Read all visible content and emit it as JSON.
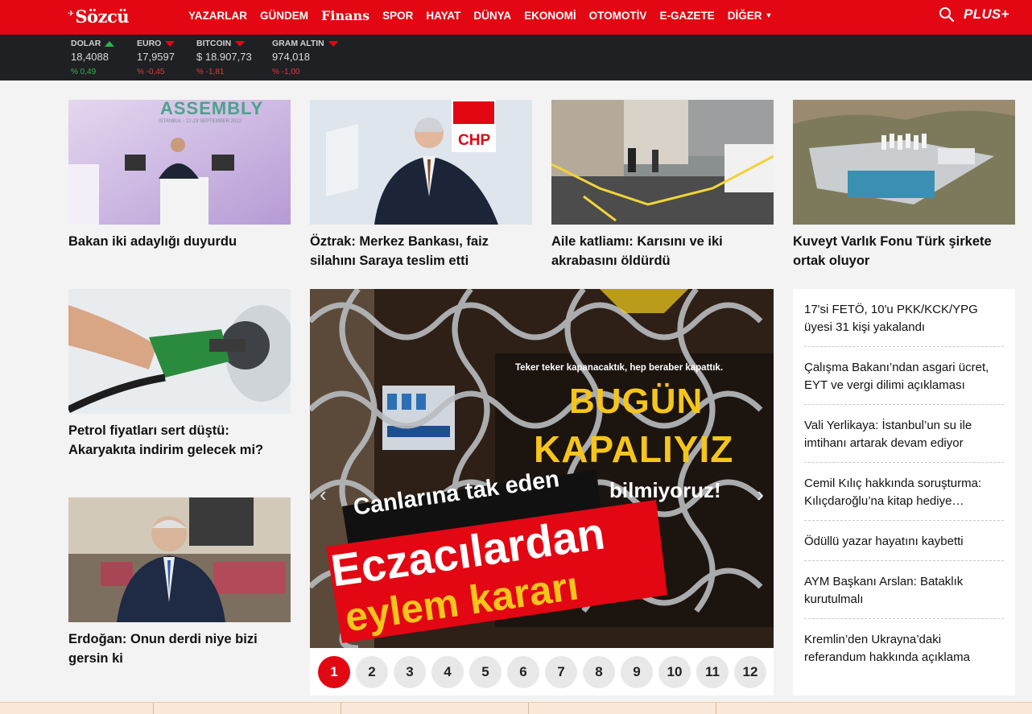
{
  "brand": {
    "name": "Sözcü",
    "plus_label": "PLUS+"
  },
  "nav": [
    "YAZARLAR",
    "GÜNDEM",
    "Finans",
    "SPOR",
    "HAYAT",
    "DÜNYA",
    "EKONOMİ",
    "OTOMOTİV",
    "E-GAZETE",
    "DİĞER"
  ],
  "markets": [
    {
      "label": "DOLAR",
      "value": "18,4088",
      "change": "% 0,49",
      "direction": "up"
    },
    {
      "label": "EURO",
      "value": "17,9597",
      "change": "% -0,45",
      "direction": "down"
    },
    {
      "label": "BITCOIN",
      "value": "$ 18.907,73",
      "change": "% -1,81",
      "direction": "down"
    },
    {
      "label": "GRAM ALTIN",
      "value": "974,018",
      "change": "% -1,00",
      "direction": "down"
    }
  ],
  "top_stories": [
    {
      "title": "Bakan iki adaylığı duyurdu",
      "image_text": "ASSEMBLY",
      "image_subtext": "ISTANBUL - 22-23 SEPTEMBER 2022"
    },
    {
      "title": "Öztrak: Merkez Bankası, faiz silahını Saraya teslim etti",
      "image_text": "CHP"
    },
    {
      "title": "Aile katliamı: Karısını ve iki akrabasını öldürdü"
    },
    {
      "title": "Kuveyt Varlık Fonu Türk şirkete ortak oluyor"
    }
  ],
  "side_stories": [
    {
      "title": "Petrol fiyatları sert düştü: Akaryakıta indirim gelecek mi?"
    },
    {
      "title": "Erdoğan: Onun derdi niye bizi gersin ki"
    }
  ],
  "slider": {
    "kicker": "Canlarına tak eden",
    "headline_line1": "Eczacılardan",
    "headline_line2": "eylem kararı",
    "sign_top": "Teker teker kapanacaktık, hep beraber kapattık.",
    "sign_big1": "BUGÜN",
    "sign_big2": "KAPALIYIZ",
    "sign_sub": "bilmiyoruz!",
    "pages": [
      "1",
      "2",
      "3",
      "4",
      "5",
      "6",
      "7",
      "8",
      "9",
      "10",
      "11",
      "12"
    ],
    "active_page": "1"
  },
  "headlines": [
    "17'si FETÖ, 10'u PKK/KCK/YPG üyesi 31 kişi yakalandı",
    "Çalışma Bakanı’ndan asgari ücret, EYT ve vergi dilimi açıklaması",
    "Vali Yerlikaya: İstanbul’un su ile imtihanı artarak devam ediyor",
    "Cemil Kılıç hakkında soruşturma: Kılıçdaroğlu’na kitap hediye…",
    "Ödüllü yazar hayatını kaybetti",
    "AYM Başkanı Arslan: Bataklık kurutulmalı",
    "Kremlin’den Ukrayna’daki referandum hakkında açıklama"
  ],
  "colors": {
    "brand_red": "#e30613",
    "market_bar": "#1f2024",
    "up": "#2fb34a",
    "down": "#e03a3a"
  }
}
